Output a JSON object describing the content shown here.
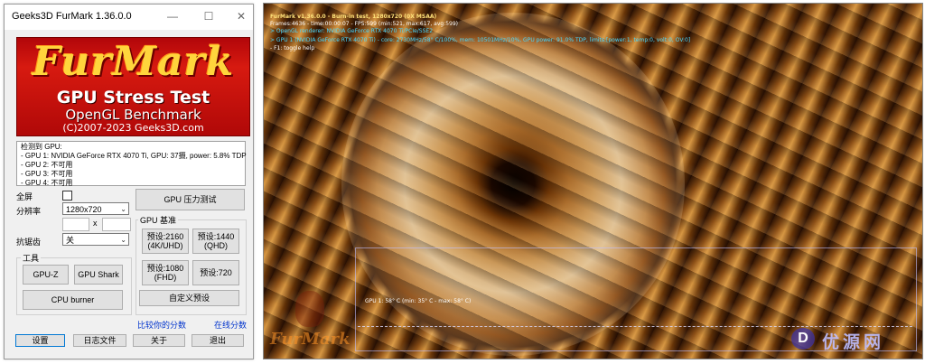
{
  "window": {
    "title": "Geeks3D FurMark 1.36.0.0",
    "controls": {
      "minimize": "—",
      "maximize": "☐",
      "close": "✕"
    }
  },
  "logo": {
    "brand": "FurMark",
    "line1": "GPU Stress Test",
    "line2": "OpenGL Benchmark",
    "line3": "(C)2007-2023 Geeks3D.com"
  },
  "gpu_info": {
    "header": "检测到 GPU:",
    "lines": [
      "- GPU 1: NVIDIA GeForce RTX 4070 Ti, GPU: 37摄, power: 5.8% TDP",
      "- GPU 2: 不可用",
      "- GPU 3: 不可用",
      "- GPU 4: 不可用"
    ]
  },
  "settings": {
    "fullscreen_label": "全屏",
    "resolution_label": "分辨率",
    "resolution_value": "1280x720",
    "custom_separator": "x",
    "antialias_label": "抗锯齿",
    "antialias_value": "关"
  },
  "buttons": {
    "gpu_stress_test": "GPU 压力测试",
    "gpu_z": "GPU-Z",
    "gpu_shark": "GPU Shark",
    "cpu_burner": "CPU burner",
    "preset_2160": "预设:2160\n(4K/UHD)",
    "preset_1440": "预设:1440\n(QHD)",
    "preset_1080": "预设:1080\n(FHD)",
    "preset_720": "预设:720",
    "custom_preset": "自定义预设",
    "settings": "设置",
    "log": "日志文件",
    "about": "关于",
    "exit": "退出"
  },
  "groups": {
    "tools": "工具",
    "gpu_benchmark": "GPU 基准"
  },
  "links": {
    "compare_score": "比较你的分数",
    "online_score": "在线分数"
  },
  "render": {
    "osd": [
      "FurMark v1.36.0.0 - Burn-in test, 1280x720 (0X MSAA)",
      "Frames:4636 - time:00:00:07 - FPS:599 (min:521, max:617, avg:599)",
      "> OpenGL renderer: NVIDIA GeForce RTX 4070 Ti/PCIe/SSE2",
      "> GPU 1 (NVIDIA GeForce RTX 4070 Ti) - core: 2730MHz/58° C/100%, mem: 10501MHz/10%, GPU power: 91.0% TDP, limits:[power:1, temp:0, volt:0, OV:0]",
      "- F1: toggle help"
    ],
    "temp_graph_label": "GPU 1: 58° C (min: 35° C - max: 58° C)",
    "watermark": "FurMark",
    "site_logo_letter": "D",
    "site_text": "优源网"
  },
  "colors": {
    "osd_title": "#ffe27a",
    "osd_info": "#48d8ff",
    "logo_red": "#d71a10",
    "logo_yellow": "#ffd53c"
  }
}
